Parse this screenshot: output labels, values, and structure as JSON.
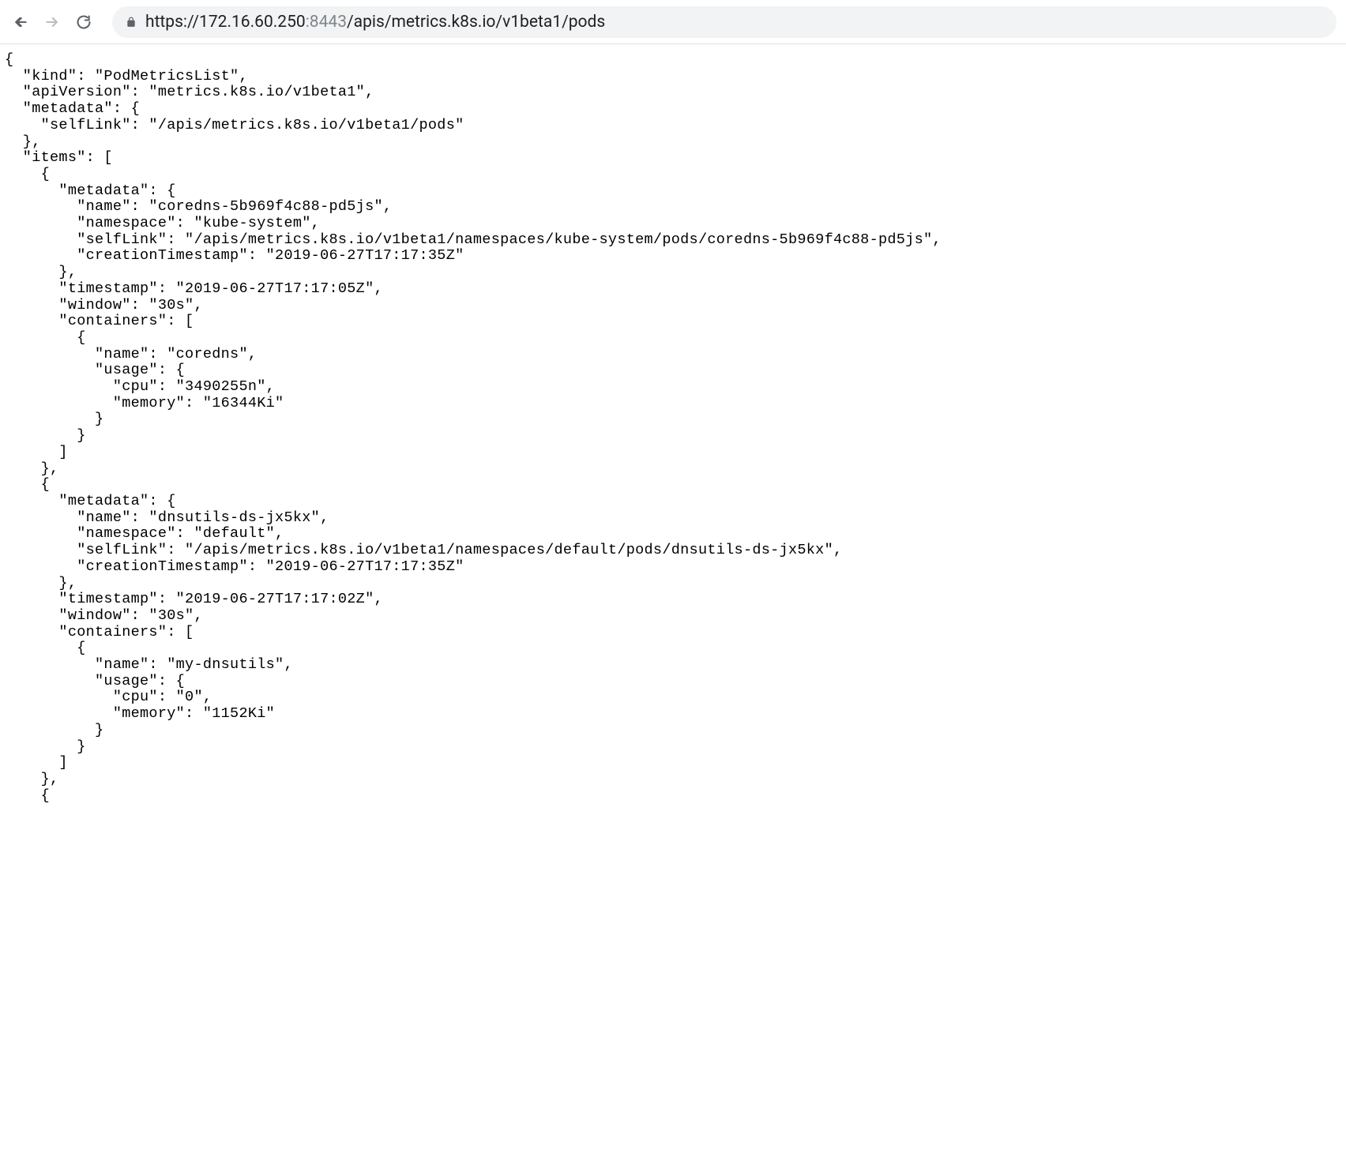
{
  "browser": {
    "url_scheme_host": "https://172.16.60.250",
    "url_port": ":8443",
    "url_path": "/apis/metrics.k8s.io/v1beta1/pods"
  },
  "response": {
    "kind": "PodMetricsList",
    "apiVersion": "metrics.k8s.io/v1beta1",
    "metadata": {
      "selfLink": "/apis/metrics.k8s.io/v1beta1/pods"
    },
    "items": [
      {
        "metadata": {
          "name": "coredns-5b969f4c88-pd5js",
          "namespace": "kube-system",
          "selfLink": "/apis/metrics.k8s.io/v1beta1/namespaces/kube-system/pods/coredns-5b969f4c88-pd5js",
          "creationTimestamp": "2019-06-27T17:17:35Z"
        },
        "timestamp": "2019-06-27T17:17:05Z",
        "window": "30s",
        "containers": [
          {
            "name": "coredns",
            "usage": {
              "cpu": "3490255n",
              "memory": "16344Ki"
            }
          }
        ]
      },
      {
        "metadata": {
          "name": "dnsutils-ds-jx5kx",
          "namespace": "default",
          "selfLink": "/apis/metrics.k8s.io/v1beta1/namespaces/default/pods/dnsutils-ds-jx5kx",
          "creationTimestamp": "2019-06-27T17:17:35Z"
        },
        "timestamp": "2019-06-27T17:17:02Z",
        "window": "30s",
        "containers": [
          {
            "name": "my-dnsutils",
            "usage": {
              "cpu": "0",
              "memory": "1152Ki"
            }
          }
        ]
      }
    ]
  }
}
